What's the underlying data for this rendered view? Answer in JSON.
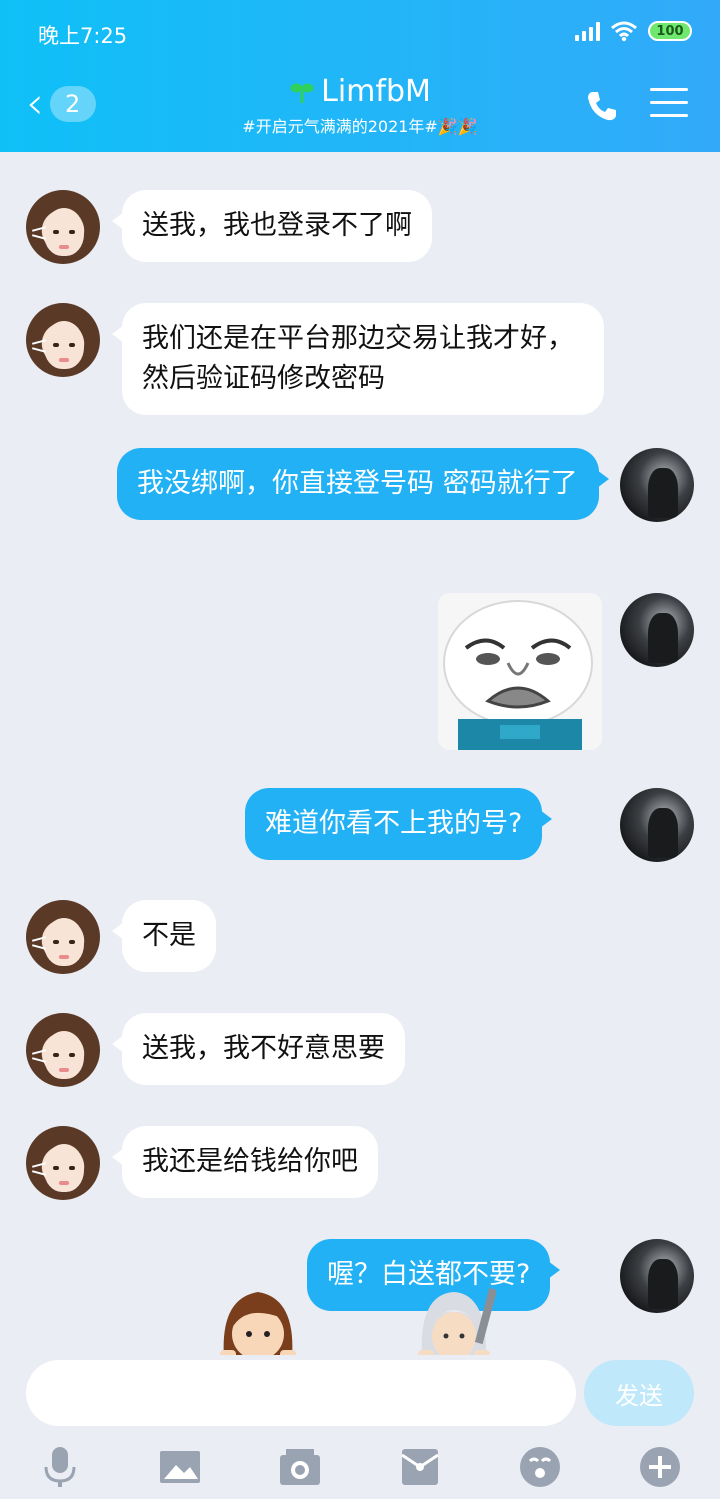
{
  "status": {
    "time": "晚上7:25",
    "battery": "100"
  },
  "header": {
    "back_count": "2",
    "title": "LimfbM",
    "subtitle": "#开启元气满满的2021年#🎉🎉"
  },
  "messages": [
    {
      "side": "in",
      "text": "送我，我也登录不了啊"
    },
    {
      "side": "in",
      "text": "我们还是在平台那边交易让我才好，然后验证码修改密码"
    },
    {
      "side": "out",
      "text": "我没绑啊，你直接登号码 密码就行了"
    },
    {
      "side": "out",
      "type": "sticker"
    },
    {
      "side": "out",
      "text": "难道你看不上我的号?"
    },
    {
      "side": "in",
      "text": "不是"
    },
    {
      "side": "in",
      "text": "送我，我不好意思要"
    },
    {
      "side": "in",
      "text": "我还是给钱给你吧"
    },
    {
      "side": "out",
      "text": "喔？白送都不要?"
    }
  ],
  "input": {
    "placeholder": "",
    "value": "",
    "send_label": "发送"
  },
  "toolbar": [
    "microphone-icon",
    "image-icon",
    "camera-icon",
    "red-packet-icon",
    "emoji-icon",
    "plus-icon"
  ],
  "colors": {
    "header_start": "#0fc0f7",
    "header_end": "#32aaf9",
    "bubble_out": "#22b1f5",
    "background": "#eaedf4"
  }
}
